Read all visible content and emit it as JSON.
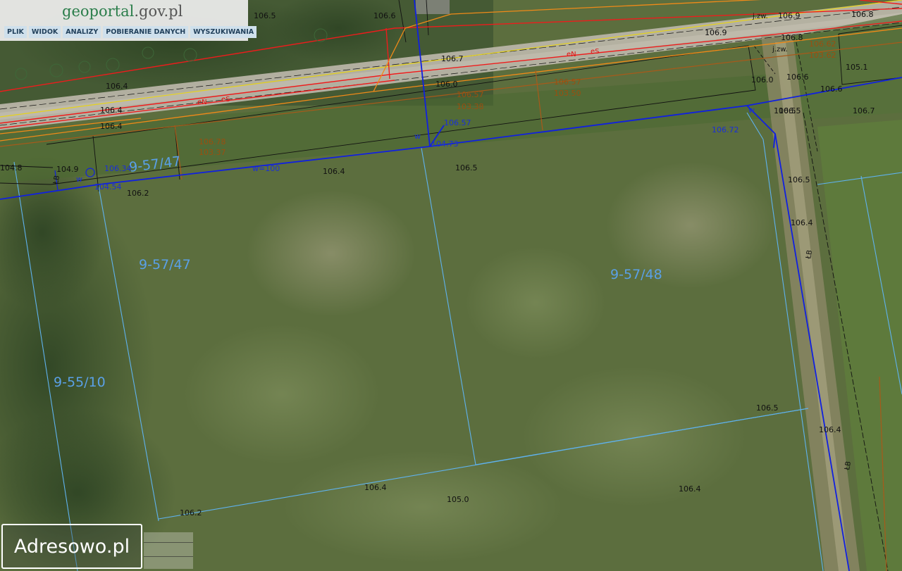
{
  "header": {
    "logo_prefix": "geo",
    "logo_brand": "portal",
    "logo_domain": ".gov.pl",
    "menu": [
      "PLIK",
      "WIDOK",
      "ANALIZY",
      "POBIERANIE DANYCH",
      "WYSZUKIWANIA"
    ]
  },
  "watermark": {
    "text": "Adresowo.pl"
  },
  "map": {
    "parcels": [
      "9-57/47",
      "9-57/47",
      "9-57/48",
      "9-55/10"
    ],
    "elevations": [
      "106.5",
      "106.6",
      "106.7",
      "106.4",
      "106.4",
      "106.4",
      "106.2",
      "106.4",
      "106.5",
      "106.5",
      "106.4",
      "106.5",
      "106.4",
      "106.4",
      "105.0",
      "106.4",
      "106.2",
      "106.9",
      "106.8",
      "106.9",
      "106.8",
      "106.0",
      "106.6",
      "106.5",
      "106.7",
      "105.1",
      "106.6",
      "104.9",
      "104.8",
      "106.0",
      "106.5"
    ],
    "blue_labels": [
      "106.57",
      "106.72",
      "106.34",
      "104.73",
      "104.54",
      "w",
      "w",
      "w",
      "w=100"
    ],
    "brown_labels": [
      "106.57",
      "103.38",
      "106.57",
      "103.50",
      "106.78",
      "103.37",
      "106.62",
      "103.62"
    ],
    "black_labels": [
      "j.zw.",
      "j.zw.",
      "ŁB",
      "ŁB",
      "ŁB"
    ],
    "red_labels": [
      "eN",
      "eS",
      "eN",
      "eS"
    ]
  }
}
